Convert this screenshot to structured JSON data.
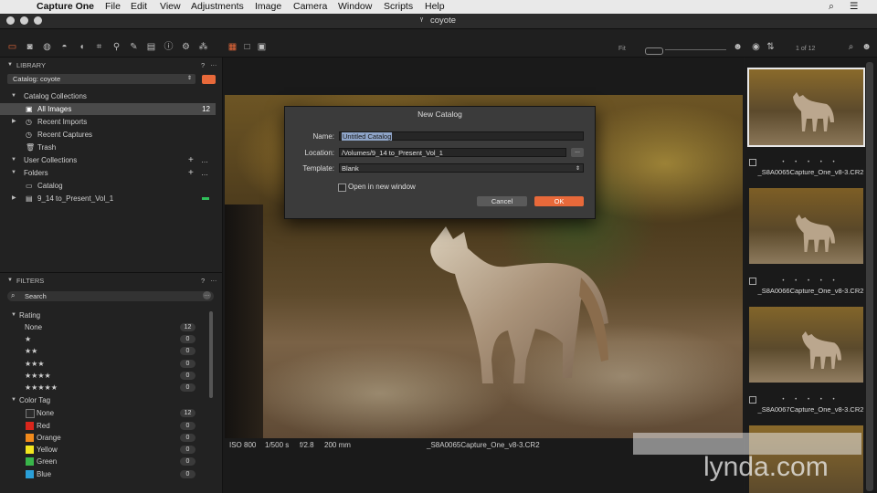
{
  "menubar": {
    "app_name": "Capture One",
    "items": [
      "File",
      "Edit",
      "View",
      "Adjustments",
      "Image",
      "Camera",
      "Window",
      "Scripts",
      "Help"
    ]
  },
  "window": {
    "title": "coyote"
  },
  "toolbar": {
    "fit_label": "Fit",
    "count_label": "1 of 12"
  },
  "library": {
    "header": "LIBRARY",
    "help": "?",
    "catalog_select": "Catalog: coyote",
    "catalog_collections_label": "Catalog Collections",
    "items": [
      {
        "label": "All Images",
        "count": "12"
      },
      {
        "label": "Recent Imports"
      },
      {
        "label": "Recent Captures"
      },
      {
        "label": "Trash"
      }
    ],
    "user_collections_label": "User Collections",
    "folders_label": "Folders",
    "folders": [
      {
        "label": "Catalog"
      },
      {
        "label": "9_14 to_Present_Vol_1"
      }
    ]
  },
  "filters": {
    "header": "FILTERS",
    "help": "?",
    "search_placeholder": "Search",
    "rating_label": "Rating",
    "ratings": [
      {
        "label": "None",
        "count": "12"
      },
      {
        "label": "★",
        "count": "0"
      },
      {
        "label": "★★",
        "count": "0"
      },
      {
        "label": "★★★",
        "count": "0"
      },
      {
        "label": "★★★★",
        "count": "0"
      },
      {
        "label": "★★★★★",
        "count": "0"
      }
    ],
    "color_tag_label": "Color Tag",
    "color_tags": [
      {
        "label": "None",
        "count": "12",
        "color": "#2a2a2a"
      },
      {
        "label": "Red",
        "count": "0",
        "color": "#d9261c"
      },
      {
        "label": "Orange",
        "count": "0",
        "color": "#f08a1c"
      },
      {
        "label": "Yellow",
        "count": "0",
        "color": "#f2e51f"
      },
      {
        "label": "Green",
        "count": "0",
        "color": "#39b54a"
      },
      {
        "label": "Blue",
        "count": "0",
        "color": "#2a9fd8"
      }
    ]
  },
  "viewer": {
    "iso": "ISO 800",
    "shutter": "1/500 s",
    "aperture": "f/2.8",
    "focal": "200 mm",
    "filename": "_S8A0065Capture_One_v8-3.CR2"
  },
  "dialog": {
    "title": "New Catalog",
    "name_label": "Name:",
    "name_value": "Untitled Catalog",
    "location_label": "Location:",
    "location_value": "/Volumes/9_14 to_Present_Vol_1",
    "browse_label": "...",
    "template_label": "Template:",
    "template_value": "Blank",
    "open_new_window_label": "Open in new window",
    "cancel_label": "Cancel",
    "ok_label": "OK"
  },
  "browser": {
    "thumbnails": [
      {
        "name": "_S8A0065Capture_One_v8-3.CR2",
        "selected": true
      },
      {
        "name": "_S8A0066Capture_One_v8-3.CR2",
        "selected": false
      },
      {
        "name": "_S8A0067Capture_One_v8-3.CR2",
        "selected": false
      }
    ],
    "rating_dots": "• • • • •"
  },
  "watermark": "lynda.com",
  "colors": {
    "accent": "#e8693a",
    "selection": "#4a4a4a",
    "panel_bg": "#222222",
    "viewer_bg": "#1a1a1a"
  }
}
